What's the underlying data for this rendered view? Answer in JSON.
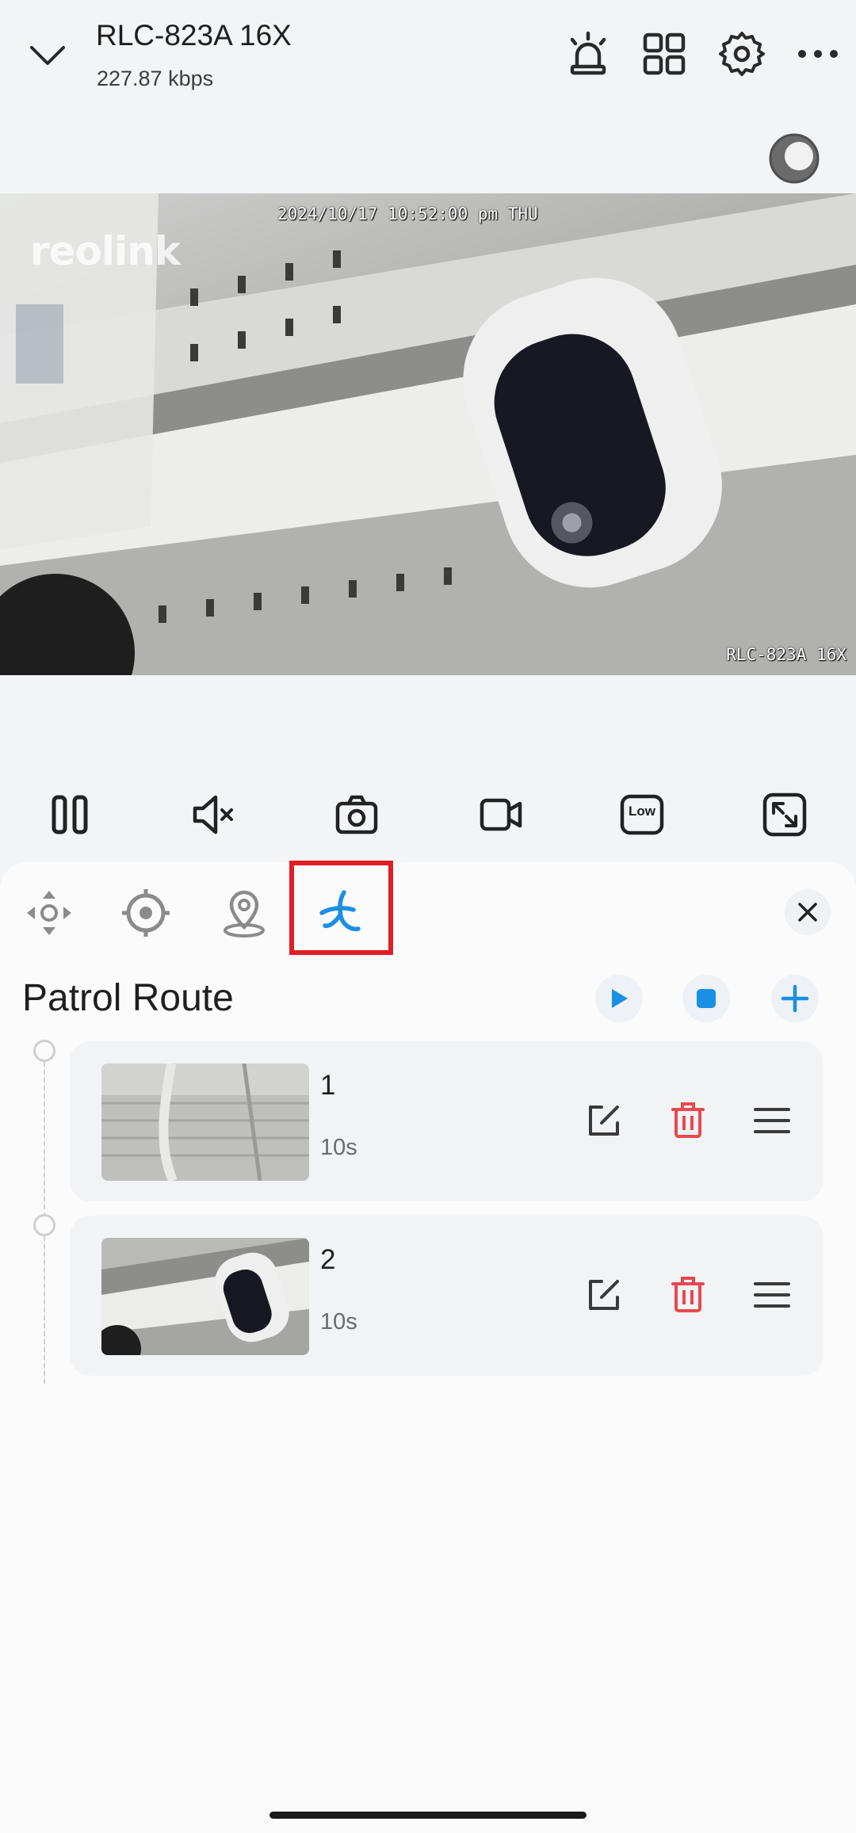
{
  "header": {
    "camera_name": "RLC-823A 16X",
    "bitrate": "227.87 kbps",
    "icons": [
      "chevron-down-icon",
      "siren-icon",
      "grid-icon",
      "gear-icon",
      "more-icon"
    ]
  },
  "video": {
    "timestamp": "2024/10/17 10:52:00 pm THU",
    "camera_label": "RLC-823A 16X",
    "logo": "reolink"
  },
  "toolbar": {
    "items": [
      "pause-icon",
      "mute-icon",
      "snapshot-icon",
      "record-icon",
      "quality-low",
      "fullscreen-icon"
    ],
    "quality_label": "Low"
  },
  "panel": {
    "tabs": [
      "ptz-direction",
      "preset",
      "preset-location",
      "patrol"
    ],
    "active_tab": "patrol",
    "title": "Patrol Route",
    "colors": {
      "accent": "#1a8fe3",
      "delete": "#e8494f",
      "highlight": "#e01e24"
    },
    "routes": [
      {
        "index": "1",
        "duration": "10s"
      },
      {
        "index": "2",
        "duration": "10s"
      }
    ]
  }
}
